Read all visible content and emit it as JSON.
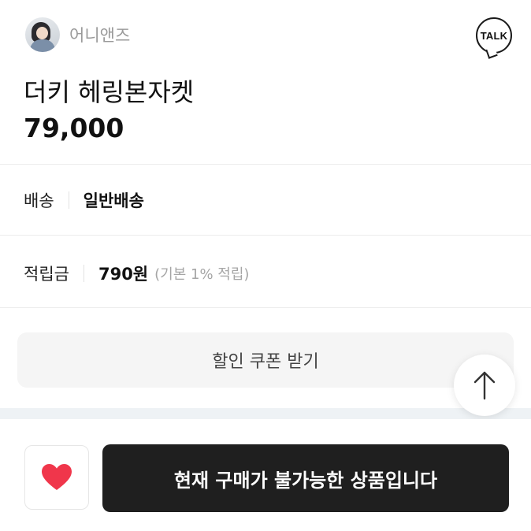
{
  "store": {
    "name": "어니앤즈"
  },
  "talk_button": {
    "label": "TALK"
  },
  "product": {
    "title": "더키 헤링본자켓",
    "price": "79,000"
  },
  "shipping": {
    "label": "배송",
    "value": "일반배송"
  },
  "points": {
    "label": "적립금",
    "value": "790원",
    "note": "(기본 1% 적립)"
  },
  "coupon": {
    "label": "할인 쿠폰 받기"
  },
  "purchase": {
    "label": "현재 구매가 불가능한 상품입니다"
  },
  "colors": {
    "heart": "#f0364b",
    "buy_button": "#1f1f1f",
    "band": "#eef2f5"
  },
  "icons": {
    "like": "heart-icon",
    "scroll_top": "arrow-up-icon",
    "talk": "kakao-talk-icon"
  }
}
